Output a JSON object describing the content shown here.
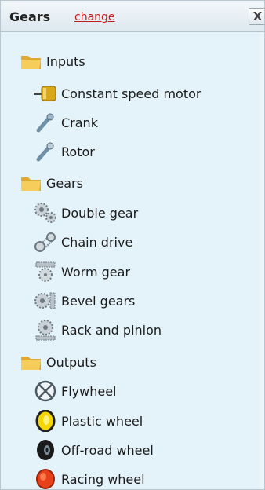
{
  "panel": {
    "title": "Gears",
    "change_link": "change",
    "close_label": "X"
  },
  "tree": {
    "inputs": {
      "label": "Inputs",
      "items": [
        "Constant speed motor",
        "Crank",
        "Rotor"
      ]
    },
    "gears": {
      "label": "Gears",
      "items": [
        "Double gear",
        "Chain drive",
        "Worm gear",
        "Bevel gears",
        "Rack and pinion"
      ]
    },
    "outputs": {
      "label": "Outputs",
      "items": [
        "Flywheel",
        "Plastic wheel",
        "Off-road wheel",
        "Racing wheel"
      ]
    }
  },
  "icons": {
    "folder": "folder-icon",
    "constant_speed_motor": "motor-icon",
    "crank": "crank-icon",
    "rotor": "rotor-icon",
    "double_gear": "double-gear-icon",
    "chain_drive": "chain-drive-icon",
    "worm_gear": "worm-gear-icon",
    "bevel_gears": "bevel-gears-icon",
    "rack_and_pinion": "rack-and-pinion-icon",
    "flywheel": "flywheel-icon",
    "plastic_wheel": "plastic-wheel-icon",
    "offroad_wheel": "offroad-wheel-icon",
    "racing_wheel": "racing-wheel-icon"
  },
  "colors": {
    "panel_background": "#e4f2f9",
    "change_link": "#c11d1d",
    "folder": "#f2c24c",
    "plastic_wheel": "#f5d600",
    "racing_wheel": "#e8401a"
  }
}
